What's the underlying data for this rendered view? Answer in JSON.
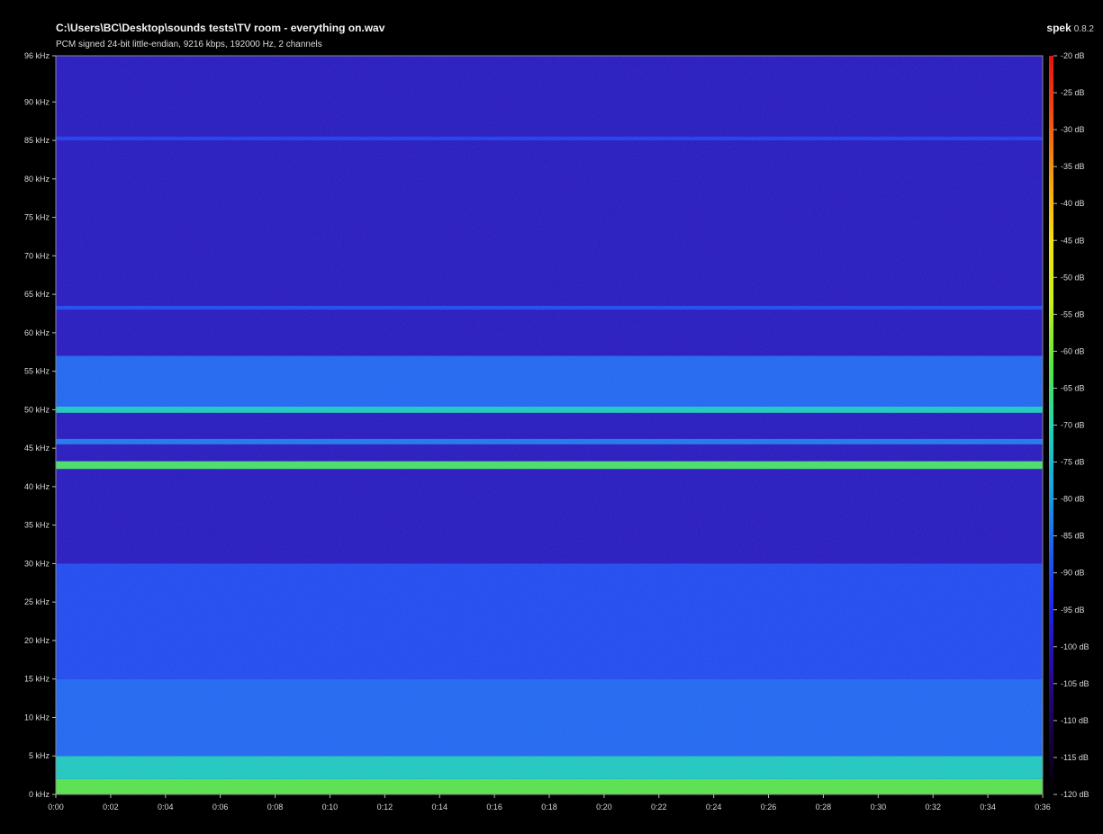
{
  "header": {
    "file_path": "C:\\Users\\BC\\Desktop\\sounds tests\\TV room - everything on.wav",
    "stream_info": "PCM signed 24-bit little-endian, 9216 kbps, 192000 Hz, 2 channels",
    "app_name": "spek",
    "app_version": "0.8.2"
  },
  "chart_data": {
    "type": "heatmap",
    "title": "",
    "xlabel": "",
    "ylabel": "",
    "x_ticks": [
      "0:00",
      "0:02",
      "0:04",
      "0:06",
      "0:08",
      "0:10",
      "0:12",
      "0:14",
      "0:16",
      "0:18",
      "0:20",
      "0:22",
      "0:24",
      "0:26",
      "0:28",
      "0:30",
      "0:32",
      "0:34",
      "0:36"
    ],
    "y_ticks": [
      "0 kHz",
      "5 kHz",
      "10 kHz",
      "15 kHz",
      "20 kHz",
      "25 kHz",
      "30 kHz",
      "35 kHz",
      "40 kHz",
      "45 kHz",
      "50 kHz",
      "55 kHz",
      "60 kHz",
      "65 kHz",
      "70 kHz",
      "75 kHz",
      "80 kHz",
      "85 kHz",
      "90 kHz",
      "96 kHz"
    ],
    "xlim_seconds": [
      0,
      36
    ],
    "ylim_khz": [
      0,
      96
    ],
    "colorbar": {
      "min_db": -120,
      "max_db": -20,
      "ticks": [
        "-20 dB",
        "-25 dB",
        "-30 dB",
        "-35 dB",
        "-40 dB",
        "-45 dB",
        "-50 dB",
        "-55 dB",
        "-60 dB",
        "-65 dB",
        "-70 dB",
        "-75 dB",
        "-80 dB",
        "-85 dB",
        "-90 dB",
        "-95 dB",
        "-100 dB",
        "-105 dB",
        "-110 dB",
        "-115 dB",
        "-120 dB"
      ],
      "colors": [
        "#000000",
        "#1a0048",
        "#2a0a9c",
        "#1f24e8",
        "#1f5ff0",
        "#19a6e0",
        "#1fd6b0",
        "#5ae640",
        "#c8f018",
        "#f5e010",
        "#f5a010",
        "#f05010",
        "#e81010"
      ]
    },
    "background_db": -100,
    "bands": [
      {
        "khz": [
          0,
          2
        ],
        "db": -62
      },
      {
        "khz": [
          2,
          5
        ],
        "db": -72
      },
      {
        "khz": [
          5,
          15
        ],
        "db": -86
      },
      {
        "khz": [
          15,
          30
        ],
        "db": -90
      },
      {
        "khz": [
          42.3,
          43.3
        ],
        "db": -64
      },
      {
        "khz": [
          45.5,
          46.2
        ],
        "db": -84
      },
      {
        "khz": [
          49.6,
          50.4
        ],
        "db": -72
      },
      {
        "khz": [
          50.4,
          57
        ],
        "db": -86
      },
      {
        "khz": [
          63,
          63.5
        ],
        "db": -90
      },
      {
        "khz": [
          85,
          85.5
        ],
        "db": -92
      }
    ]
  }
}
